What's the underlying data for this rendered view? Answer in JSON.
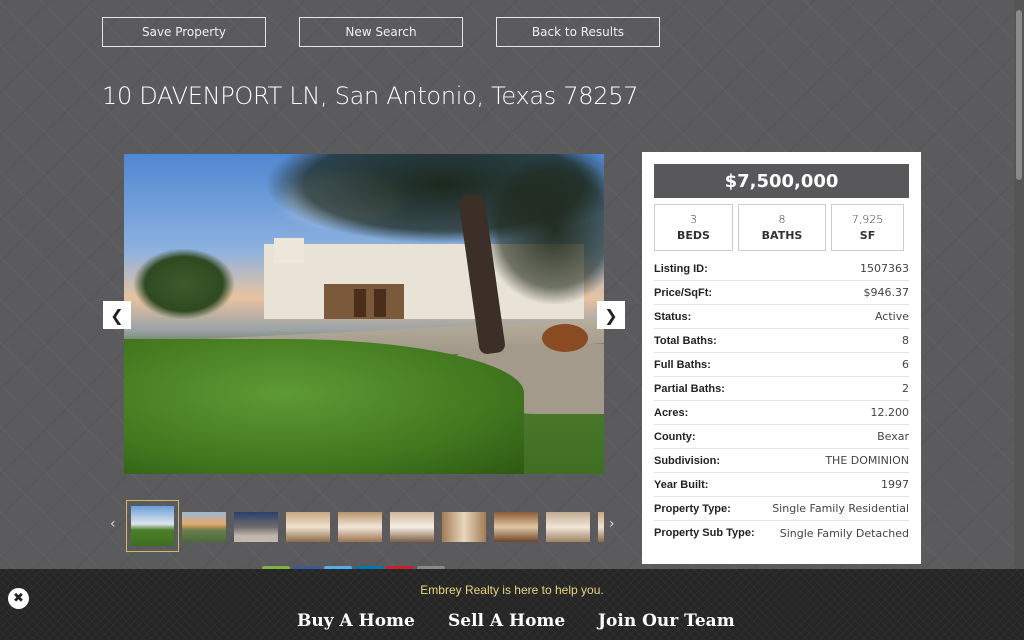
{
  "top_buttons": {
    "save": "Save Property",
    "new_search": "New Search",
    "back": "Back to Results"
  },
  "address": "10 DAVENPORT LN, San Antonio, Texas 78257",
  "gallery": {
    "prev_icon": "chevron-left-icon",
    "next_icon": "chevron-right-icon",
    "thumb_prev": "‹",
    "thumb_next": "›",
    "thumbnail_count_visible": 10
  },
  "listing": {
    "price": "$7,500,000",
    "beds": {
      "value": "3",
      "label": "BEDS"
    },
    "baths": {
      "value": "8",
      "label": "BATHS"
    },
    "sf": {
      "value": "7,925",
      "label": "SF"
    },
    "details": [
      {
        "key": "Listing ID:",
        "value": "1507363"
      },
      {
        "key": "Price/SqFt:",
        "value": "$946.37"
      },
      {
        "key": "Status:",
        "value": "Active"
      },
      {
        "key": "Total Baths:",
        "value": "8"
      },
      {
        "key": "Full Baths:",
        "value": "6"
      },
      {
        "key": "Partial Baths:",
        "value": "2"
      },
      {
        "key": "Acres:",
        "value": "12.200"
      },
      {
        "key": "County:",
        "value": "Bexar"
      },
      {
        "key": "Subdivision:",
        "value": "THE DOMINION"
      },
      {
        "key": "Year Built:",
        "value": "1997"
      },
      {
        "key": "Property Type:",
        "value": "Single Family Residential"
      },
      {
        "key": "Property Sub Type:",
        "value": "Single Family Detached"
      }
    ]
  },
  "footer": {
    "tagline": "Embrey Realty is here to help you.",
    "nav": {
      "buy": "Buy A Home",
      "sell": "Sell A Home",
      "join": "Join Our Team"
    },
    "close_icon": "close-icon"
  },
  "colors": {
    "page_bg": "#5b5b5d",
    "price_bar": "#58585a",
    "footer_bg": "#262626",
    "tagline": "#e8d67a",
    "thumb_active_border": "#c9bd6a"
  }
}
